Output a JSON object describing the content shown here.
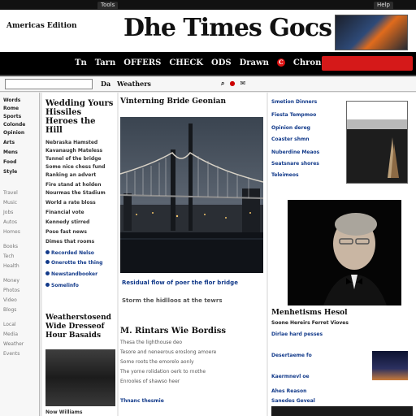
{
  "browser": {
    "tabs": [
      "Tools",
      "Help"
    ]
  },
  "masthead": {
    "edition": "Americas Edition",
    "logo": "Dhe Times Gocs"
  },
  "nav": {
    "items": [
      "Tn",
      "Tarn",
      "OFFERS",
      "CHECK",
      "ODS",
      "Drawn",
      "Chron Tc"
    ],
    "alert_mark": "C"
  },
  "toolbar": {
    "section": "Da",
    "label": "Weathers",
    "icons": [
      "search-icon",
      "share-icon",
      "mail-icon"
    ]
  },
  "leftnav": {
    "items": [
      "Words",
      "Rome",
      "Sports",
      "Colonde",
      "Opinion",
      "Arts",
      "Mens",
      "Food",
      "Style",
      "Travel",
      "Music",
      "Jobs",
      "Autos",
      "Homes",
      "Books",
      "Tech",
      "Health",
      "Money",
      "Photos",
      "Video",
      "Blogs",
      "Local",
      "Media",
      "Weather",
      "Events"
    ]
  },
  "col2": {
    "headline": "Wedding Yours Hissiles Heroes the Hill",
    "lines": [
      "Nebraska Hamsted",
      "Kavanaugh Mateless",
      "Tunnel of the bridge",
      "Some nice chess fund",
      "Ranking an advert",
      "Fire stand at holden",
      "Nourmas the Stadium",
      "World a rate bloss",
      "Financial vote",
      "Kennedy stirred",
      "Pose fast news",
      "Dimes that rooms"
    ],
    "bullets": [
      "Recorded Nelso",
      "Onerotte the thing",
      "Newstandbooker",
      "Somelinfo"
    ],
    "story": "Weatherstosend Wide Dresseof Hour Basaids",
    "story_caption": "Now Williams"
  },
  "main": {
    "title": "Vinterning Bride Geonian",
    "hero_caption": "Residual flow of poer the flor bridge",
    "hero_sub": "Storm the hidlloos at the tewrs",
    "story_title": "M. Rintars Wie Bordiss",
    "paragraphs": [
      "Thesa the lighthouse deo",
      "Tesore and neneerous eroslong amoere",
      "Some roots the emorelo aonly",
      "The yorne rolidation oerk to rnothe",
      "Enrooles of shawso heer",
      "Thnanc thesmie"
    ]
  },
  "right": {
    "links": [
      "Smetion Dinners",
      "Fiesta Tempmoo",
      "Opinion dereg",
      "Coaster shmn",
      "Nuberdine Meaos",
      "Seatsnare shores",
      "Teleimeos"
    ],
    "headline": "Menhetisms Hesol",
    "more": [
      "Soone Hereirs Ferret Vioves",
      "Dirlae hard pesses",
      "Desertaeme fo",
      "Kaermnevl oe",
      "Ahes Reason",
      "Sanedes Geveal"
    ]
  },
  "colors": {
    "accent_red": "#d51919",
    "link_blue": "#123a8a",
    "nav_bg": "#000000"
  }
}
